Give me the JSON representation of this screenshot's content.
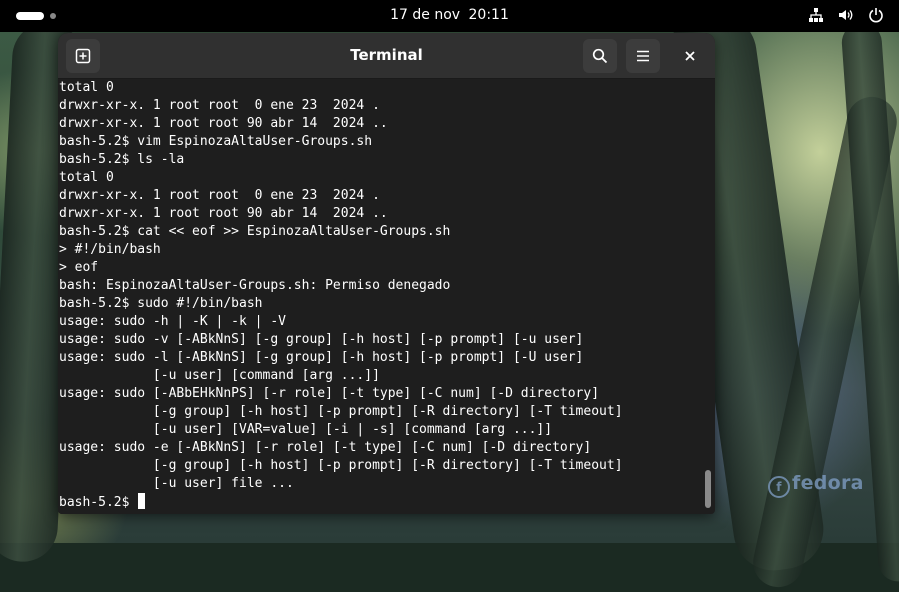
{
  "topbar": {
    "date": "17 de nov",
    "time": "20:11",
    "icons": [
      "workspace-indicator",
      "network-icon",
      "volume-icon",
      "power-icon"
    ]
  },
  "desktop": {
    "logo_text": "fedora"
  },
  "window": {
    "title": "Terminal",
    "buttons": [
      "new-tab-icon",
      "search-icon",
      "menu-icon",
      "close-icon"
    ]
  },
  "terminal": {
    "lines": [
      "total 0",
      "drwxr-xr-x. 1 root root  0 ene 23  2024 .",
      "drwxr-xr-x. 1 root root 90 abr 14  2024 ..",
      "bash-5.2$ vim EspinozaAltaUser-Groups.sh",
      "bash-5.2$ ls -la",
      "total 0",
      "drwxr-xr-x. 1 root root  0 ene 23  2024 .",
      "drwxr-xr-x. 1 root root 90 abr 14  2024 ..",
      "bash-5.2$ cat << eof >> EspinozaAltaUser-Groups.sh",
      "> #!/bin/bash",
      "> eof",
      "bash: EspinozaAltaUser-Groups.sh: Permiso denegado",
      "bash-5.2$ sudo #!/bin/bash",
      "usage: sudo -h | -K | -k | -V",
      "usage: sudo -v [-ABkNnS] [-g group] [-h host] [-p prompt] [-u user]",
      "usage: sudo -l [-ABkNnS] [-g group] [-h host] [-p prompt] [-U user]",
      "            [-u user] [command [arg ...]]",
      "usage: sudo [-ABbEHkNnPS] [-r role] [-t type] [-C num] [-D directory]",
      "            [-g group] [-h host] [-p prompt] [-R directory] [-T timeout]",
      "            [-u user] [VAR=value] [-i | -s] [command [arg ...]]",
      "usage: sudo -e [-ABkNnS] [-r role] [-t type] [-C num] [-D directory]",
      "            [-g group] [-h host] [-p prompt] [-R directory] [-T timeout]",
      "            [-u user] file ..."
    ],
    "prompt": "bash-5.2$ "
  },
  "colors": {
    "terminal_bg": "#1e1e1e",
    "headerbar_bg": "#303030",
    "topbar_bg": "#000000"
  }
}
